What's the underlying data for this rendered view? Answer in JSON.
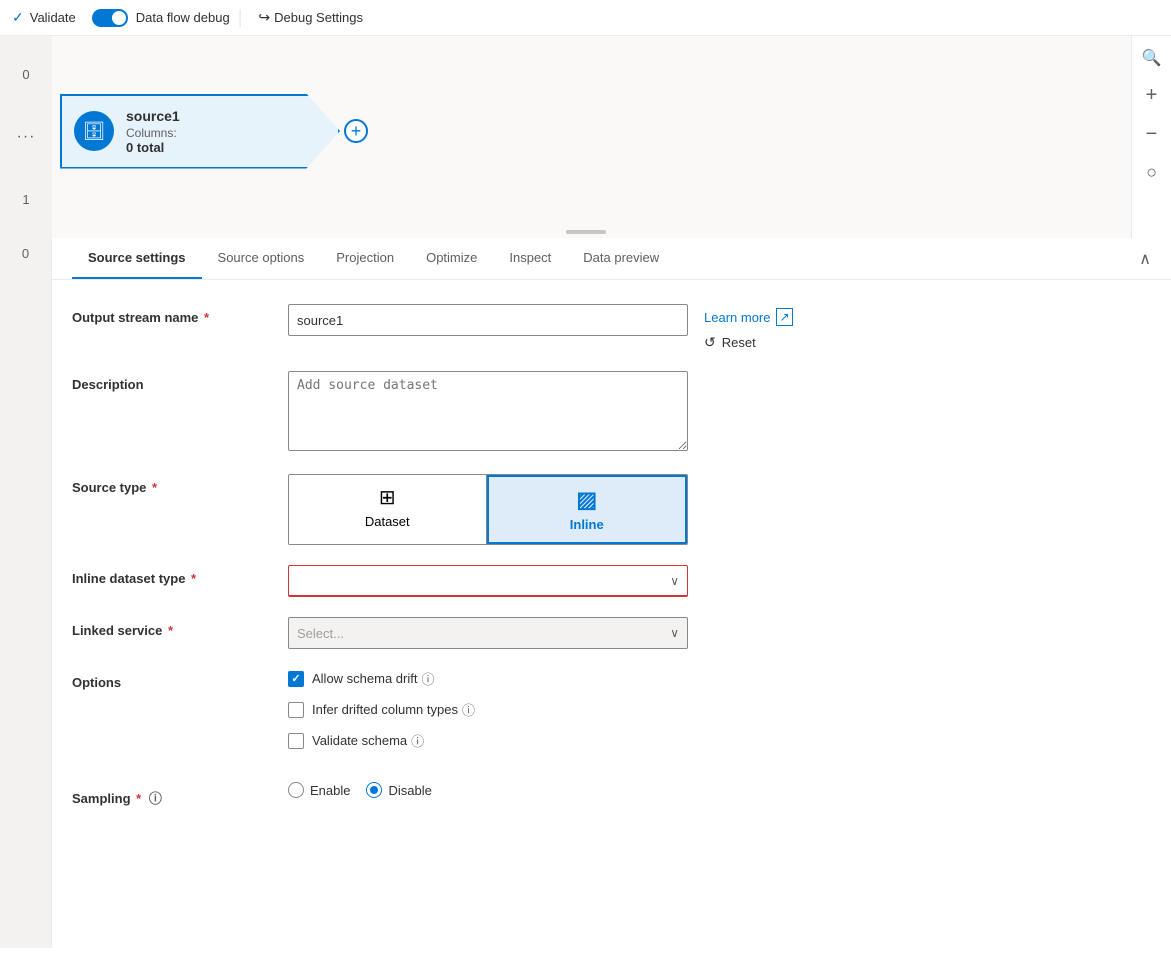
{
  "toolbar": {
    "validate_label": "Validate",
    "data_flow_debug_label": "Data flow debug",
    "debug_settings_label": "Debug Settings"
  },
  "node": {
    "name": "source1",
    "columns_label": "Columns:",
    "columns_value": "0 total",
    "icon": "🗄",
    "add_icon": "+"
  },
  "tabs": [
    {
      "id": "source-settings",
      "label": "Source settings"
    },
    {
      "id": "source-options",
      "label": "Source options"
    },
    {
      "id": "projection",
      "label": "Projection"
    },
    {
      "id": "optimize",
      "label": "Optimize"
    },
    {
      "id": "inspect",
      "label": "Inspect"
    },
    {
      "id": "data-preview",
      "label": "Data preview"
    }
  ],
  "active_tab": "source-settings",
  "form": {
    "output_stream_name": {
      "label": "Output stream name",
      "required": true,
      "value": "source1"
    },
    "description": {
      "label": "Description",
      "placeholder": "Add source dataset"
    },
    "source_type": {
      "label": "Source type",
      "required": true,
      "options": [
        {
          "id": "dataset",
          "label": "Dataset",
          "icon": "⊞"
        },
        {
          "id": "inline",
          "label": "Inline",
          "icon": "▨"
        }
      ],
      "active": "inline"
    },
    "inline_dataset_type": {
      "label": "Inline dataset type",
      "required": true,
      "value": "",
      "placeholder": ""
    },
    "linked_service": {
      "label": "Linked service",
      "required": true,
      "placeholder": "Select...",
      "value": ""
    },
    "options": {
      "label": "Options",
      "checkboxes": [
        {
          "id": "allow-schema-drift",
          "label": "Allow schema drift",
          "checked": true,
          "info": true
        },
        {
          "id": "infer-drifted",
          "label": "Infer drifted column types",
          "checked": false,
          "info": true
        },
        {
          "id": "validate-schema",
          "label": "Validate schema",
          "checked": false,
          "info": true
        }
      ]
    },
    "sampling": {
      "label": "Sampling",
      "required": true,
      "info": true,
      "options": [
        {
          "id": "enable",
          "label": "Enable"
        },
        {
          "id": "disable",
          "label": "Disable"
        }
      ],
      "active": "disable"
    }
  },
  "actions": {
    "learn_more": "Learn more",
    "reset": "Reset"
  },
  "sidebar": {
    "numbers": [
      "0",
      "...",
      "1",
      "0"
    ]
  }
}
